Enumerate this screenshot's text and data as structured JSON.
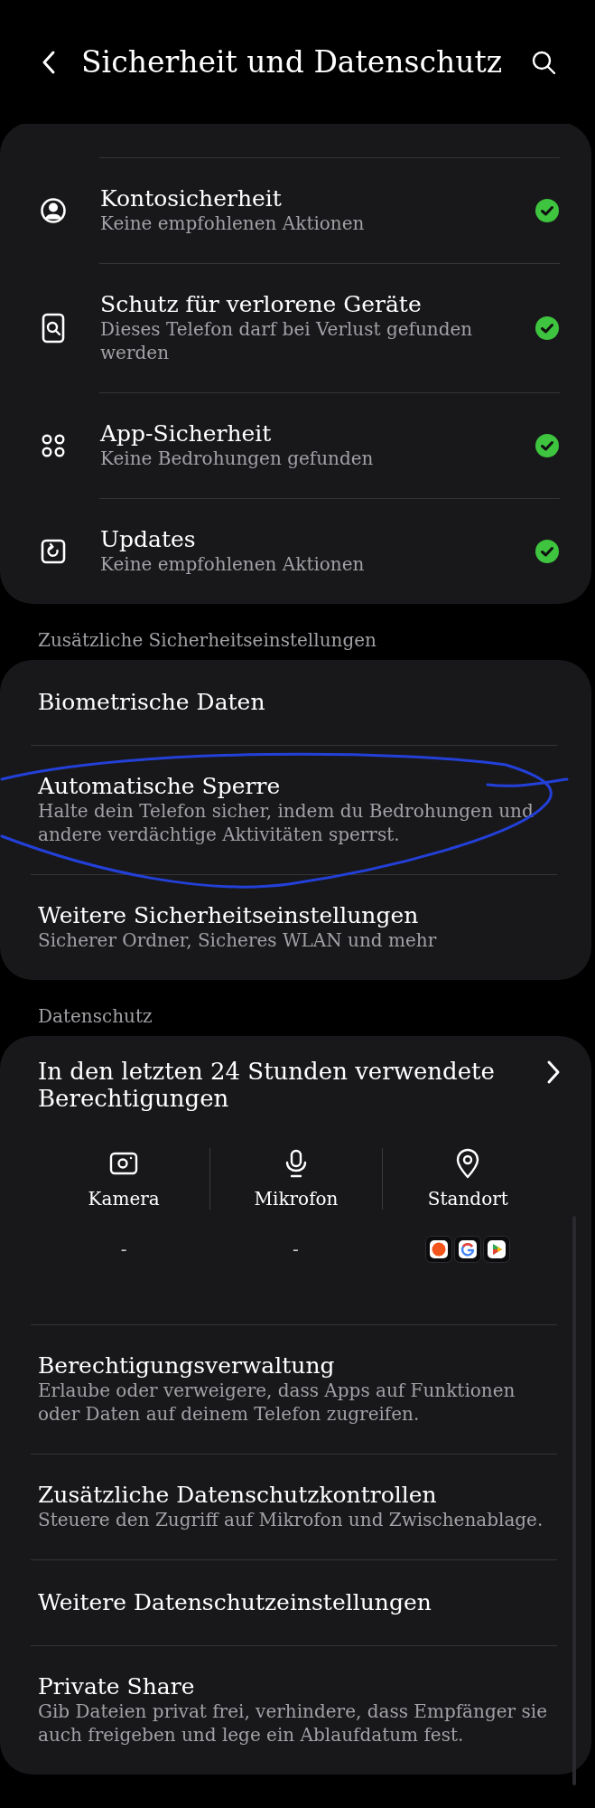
{
  "header": {
    "title": "Sicherheit und Datenschutz"
  },
  "security_card": {
    "items": [
      {
        "kind": "account",
        "title": "Kontosicherheit",
        "subtitle": "Keine empfohlenen Aktionen",
        "ok": true
      },
      {
        "kind": "lost-device",
        "title": "Schutz für verlorene Geräte",
        "subtitle": "Dieses Telefon darf bei Verlust gefunden werden",
        "ok": true
      },
      {
        "kind": "apps",
        "title": "App-Sicherheit",
        "subtitle": "Keine Bedrohungen gefunden",
        "ok": true
      },
      {
        "kind": "updates",
        "title": "Updates",
        "subtitle": "Keine empfohlenen Aktionen",
        "ok": true
      }
    ]
  },
  "additional_security": {
    "heading": "Zusätzliche Sicherheitseinstellungen",
    "items": [
      {
        "title": "Biometrische Daten"
      },
      {
        "title": "Automatische Sperre",
        "subtitle": "Halte dein Telefon sicher, indem du Bedrohungen und andere verdächtige Aktivitäten sperrst."
      },
      {
        "title": "Weitere Sicherheitseinstellungen",
        "subtitle": "Sicherer Ordner, Sicheres WLAN und mehr"
      }
    ]
  },
  "privacy": {
    "heading": "Datenschutz",
    "recent_title": "In den letzten 24 Stunden verwendete Berechtigungen",
    "permissions": [
      {
        "kind": "camera",
        "label": "Kamera",
        "value": "-"
      },
      {
        "kind": "microphone",
        "label": "Mikrofon",
        "value": "-"
      },
      {
        "kind": "location",
        "label": "Standort",
        "apps": [
          {
            "kind": "sun"
          },
          {
            "kind": "google"
          },
          {
            "kind": "play"
          }
        ]
      }
    ],
    "items": [
      {
        "title": "Berechtigungsverwaltung",
        "subtitle": "Erlaube oder verweigere, dass Apps auf Funktionen oder Daten auf deinem Telefon zugreifen."
      },
      {
        "title": "Zusätzliche Datenschutzkontrollen",
        "subtitle": "Steuere den Zugriff auf Mikrofon und Zwischenablage."
      },
      {
        "title": "Weitere Datenschutzeinstellungen"
      },
      {
        "title": "Private Share",
        "subtitle": "Gib Dateien privat frei, verhindere, dass Empfänger sie auch freigeben und lege ein Ablaufdatum fest."
      }
    ]
  }
}
